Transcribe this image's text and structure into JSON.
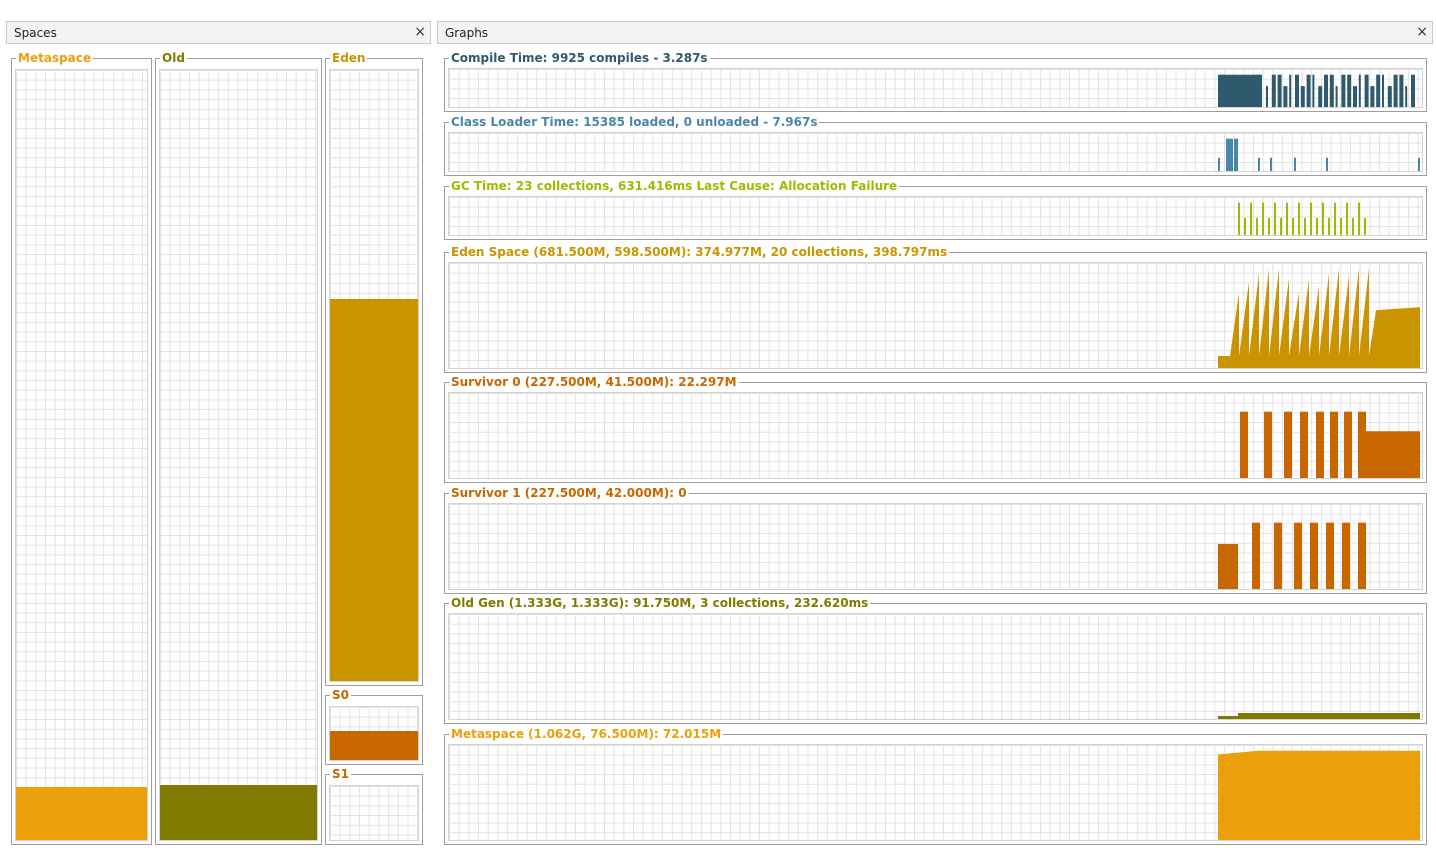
{
  "spaces_panel": {
    "title": "Spaces",
    "close": "×",
    "bars": [
      {
        "key": "metaspace",
        "label": "Metaspace",
        "color": "#eb9f0b",
        "fill": 0.069
      },
      {
        "key": "old",
        "label": "Old",
        "color": "#807a00",
        "fill": 0.072
      },
      {
        "key": "eden",
        "label": "Eden",
        "color": "#c99400",
        "fill": 0.625
      },
      {
        "key": "s0",
        "label": "S0",
        "color": "#c86600",
        "fill": 0.55
      },
      {
        "key": "s1",
        "label": "S1",
        "color": "#c86600",
        "fill": 0
      }
    ]
  },
  "graphs_panel": {
    "title": "Graphs",
    "close": "×",
    "graphs": [
      {
        "key": "compile",
        "label": "Compile Time: 9925 compiles - 3.287s",
        "color": "#2f5a6e"
      },
      {
        "key": "classloader",
        "label": "Class Loader Time: 15385 loaded, 0 unloaded - 7.967s",
        "color": "#4a86a8"
      },
      {
        "key": "gc",
        "label": "GC Time: 23 collections, 631.416ms Last Cause: Allocation Failure",
        "color": "#a3b800"
      },
      {
        "key": "eden",
        "label": "Eden Space (681.500M, 598.500M): 374.977M, 20 collections, 398.797ms",
        "color": "#c99400"
      },
      {
        "key": "s0",
        "label": "Survivor 0 (227.500M, 41.500M): 22.297M",
        "color": "#c86600"
      },
      {
        "key": "s1",
        "label": "Survivor 1 (227.500M, 42.000M): 0",
        "color": "#c86600"
      },
      {
        "key": "old",
        "label": "Old Gen (1.333G, 1.333G): 91.750M, 3 collections, 232.620ms",
        "color": "#807a00"
      },
      {
        "key": "meta",
        "label": "Metaspace (1.062G, 76.500M): 72.015M",
        "color": "#eb9f0b"
      }
    ]
  }
}
